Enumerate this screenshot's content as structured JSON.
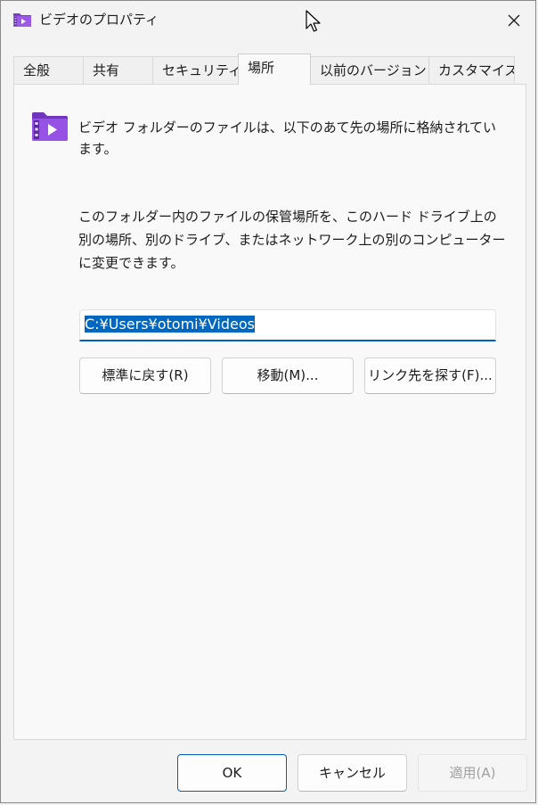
{
  "window": {
    "title": "ビデオのプロパティ",
    "close_icon": "close-icon"
  },
  "tabs": [
    {
      "label": "全般"
    },
    {
      "label": "共有"
    },
    {
      "label": "セキュリティ"
    },
    {
      "label": "場所",
      "active": true
    },
    {
      "label": "以前のバージョン"
    },
    {
      "label": "カスタマイズ"
    }
  ],
  "location": {
    "folder_icon": "video-folder-icon",
    "description_1": "ビデオ フォルダーのファイルは、以下のあて先の場所に格納されています。",
    "description_2": "このフォルダー内のファイルの保管場所を、このハード ドライブ上の別の場所、別のドライブ、またはネットワーク上の別のコンピューターに変更できます。",
    "path_value": "C:¥Users¥otomi¥Videos",
    "restore_default_label": "標準に戻す(R)",
    "move_label": "移動(M)...",
    "find_target_label": "リンク先を探す(F)..."
  },
  "footer": {
    "ok_label": "OK",
    "cancel_label": "キャンセル",
    "apply_label": "適用(A)"
  },
  "colors": {
    "accent": "#005fb8",
    "selection": "#0067c0",
    "folder_purple": "#8b46d8"
  }
}
